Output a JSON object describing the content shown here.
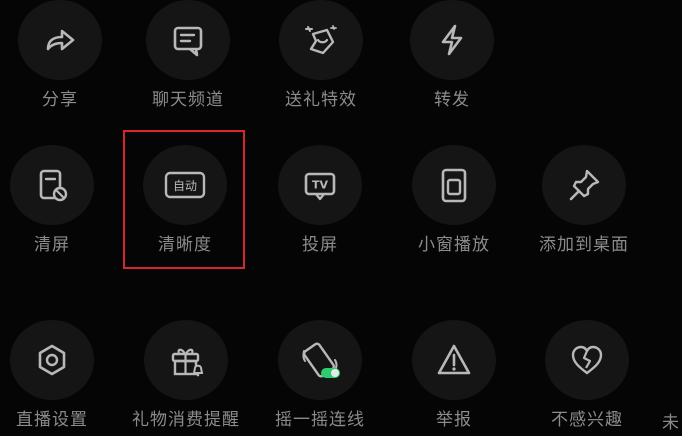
{
  "rows": [
    {
      "items": [
        {
          "label": "分享",
          "icon": "share-icon"
        },
        {
          "label": "聊天频道",
          "icon": "chat-channel-icon"
        },
        {
          "label": "送礼特效",
          "icon": "gift-effects-icon"
        },
        {
          "label": "转发",
          "icon": "forward-icon"
        }
      ]
    },
    {
      "items": [
        {
          "label": "清屏",
          "icon": "clear-screen-icon"
        },
        {
          "label": "清晰度",
          "icon": "quality-icon",
          "badge": "自动"
        },
        {
          "label": "投屏",
          "icon": "cast-screen-icon",
          "badge": "TV"
        },
        {
          "label": "小窗播放",
          "icon": "mini-window-icon"
        },
        {
          "label": "添加到桌面",
          "icon": "pin-icon"
        }
      ]
    },
    {
      "items": [
        {
          "label": "直播设置",
          "icon": "settings-icon"
        },
        {
          "label": "礼物消费提醒",
          "icon": "gift-reminder-icon"
        },
        {
          "label": "摇一摇连线",
          "icon": "shake-connect-icon"
        },
        {
          "label": "举报",
          "icon": "report-icon"
        },
        {
          "label": "不感兴趣",
          "icon": "not-interested-icon"
        }
      ]
    }
  ],
  "edge_label": "未",
  "colors": {
    "background": "#050505",
    "circle": "#151515",
    "icon": "#b8b8b8",
    "label": "#8b8b8b",
    "highlight": "#d9252b",
    "toggle_on": "#2ecc71"
  }
}
